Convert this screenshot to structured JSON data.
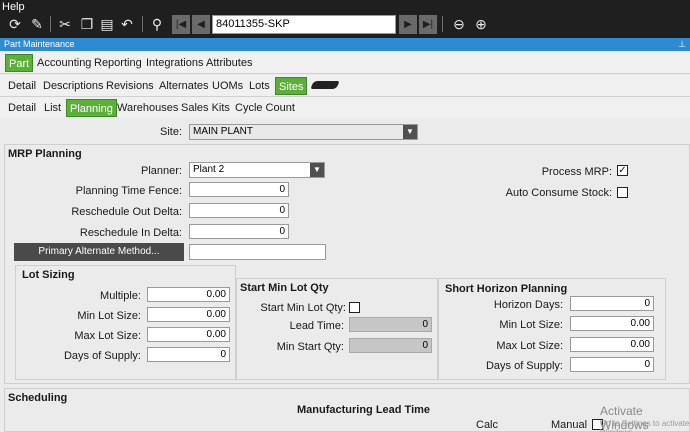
{
  "menu": {
    "help": "Help"
  },
  "toolbar": {
    "icons": [
      "refresh-icon",
      "clear-icon",
      "cut-icon",
      "copy-icon",
      "paste-icon",
      "undo-icon",
      "binoculars-icon",
      "first-record-icon",
      "previous-record-icon",
      "next-record-icon",
      "last-record-icon",
      "back-icon",
      "forward-icon"
    ],
    "part_number": "84011355-SKP"
  },
  "window": {
    "title": "Part Maintenance"
  },
  "tabs_level1": [
    {
      "label": "Part",
      "active": true
    },
    {
      "label": "Accounting",
      "active": false
    },
    {
      "label": "Reporting",
      "active": false
    },
    {
      "label": "Integrations",
      "active": false
    },
    {
      "label": "Attributes",
      "active": false
    }
  ],
  "tabs_level2": [
    {
      "label": "Detail",
      "active": false
    },
    {
      "label": "Descriptions",
      "active": false
    },
    {
      "label": "Revisions",
      "active": false
    },
    {
      "label": "Alternates",
      "active": false
    },
    {
      "label": "UOMs",
      "active": false
    },
    {
      "label": "Lots",
      "active": false
    },
    {
      "label": "Sites",
      "active": true
    }
  ],
  "tabs_level3": [
    {
      "label": "Detail",
      "active": false
    },
    {
      "label": "List",
      "active": false
    },
    {
      "label": "Planning",
      "active": true
    },
    {
      "label": "Warehouses",
      "active": false
    },
    {
      "label": "Sales Kits",
      "active": false
    },
    {
      "label": "Cycle Count",
      "active": false
    }
  ],
  "site": {
    "label": "Site:",
    "value": "MAIN PLANT"
  },
  "mrp": {
    "header": "MRP Planning",
    "planner_label": "Planner:",
    "planner_value": "Plant 2",
    "time_fence_label": "Planning Time Fence:",
    "time_fence_value": "0",
    "resched_out_label": "Reschedule Out Delta:",
    "resched_out_value": "0",
    "resched_in_label": "Reschedule In Delta:",
    "resched_in_value": "0",
    "primary_alt_button": "Primary Alternate Method...",
    "primary_alt_value": "",
    "process_mrp_label": "Process MRP:",
    "process_mrp_checked": true,
    "auto_consume_label": "Auto Consume Stock:",
    "auto_consume_checked": false
  },
  "lot_sizing": {
    "header": "Lot Sizing",
    "multiple_label": "Multiple:",
    "multiple_value": "0.00",
    "min_lot_label": "Min Lot Size:",
    "min_lot_value": "0.00",
    "max_lot_label": "Max Lot Size:",
    "max_lot_value": "0.00",
    "days_supply_label": "Days of Supply:",
    "days_supply_value": "0"
  },
  "start_min": {
    "header": "Start Min Lot Qty",
    "check_label": "Start Min Lot Qty:",
    "checked": false,
    "lead_time_label": "Lead Time:",
    "lead_time_value": "0",
    "min_start_label": "Min Start Qty:",
    "min_start_value": "0"
  },
  "short_horizon": {
    "header": "Short Horizon Planning",
    "horizon_days_label": "Horizon Days:",
    "horizon_days_value": "0",
    "min_lot_label": "Min Lot Size:",
    "min_lot_value": "0.00",
    "max_lot_label": "Max Lot Size:",
    "max_lot_value": "0.00",
    "days_supply_label": "Days of Supply:",
    "days_supply_value": "0"
  },
  "scheduling": {
    "header": "Scheduling",
    "mfg_lead_header": "Manufacturing Lead Time",
    "calc_label": "Calc",
    "manual_label": "Manual"
  },
  "watermark": {
    "title": "Activate Windows",
    "subtitle": "Go to Settings to activate Windows."
  }
}
